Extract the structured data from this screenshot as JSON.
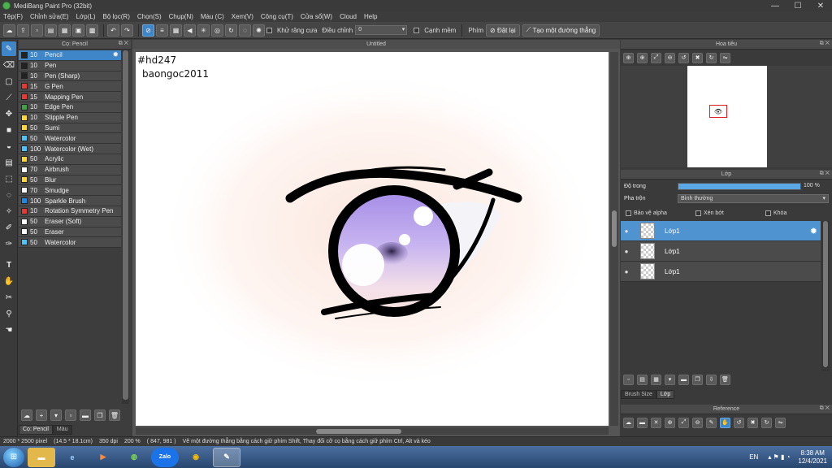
{
  "window": {
    "title": "MediBang Paint Pro (32bit)",
    "minimize": "—",
    "maximize": "☐",
    "close": "✕"
  },
  "menu": [
    "Tệp(F)",
    "Chỉnh sửa(E)",
    "Lớp(L)",
    "Bộ lọc(R)",
    "Chọn(S)",
    "Chụp(N)",
    "Màu (C)",
    "Xem(V)",
    "Công cụ(T)",
    "Cửa sổ(W)",
    "Cloud",
    "Help"
  ],
  "toolbar": {
    "antialias_label": "Khử răng cưa",
    "adjust_label": "Điều chỉnh",
    "adjust_value": "0",
    "sharp_label": "Cạnh mềm",
    "key_label": "Phím",
    "reset_label": "Đặt lại",
    "straight_label": "Tạo một đường thẳng"
  },
  "brush_panel": {
    "title": "Cọ: Pencil",
    "brushes": [
      {
        "size": "10",
        "name": "Pencil",
        "color": "#222222"
      },
      {
        "size": "10",
        "name": "Pen",
        "color": "#222222"
      },
      {
        "size": "10",
        "name": "Pen (Sharp)",
        "color": "#222222"
      },
      {
        "size": "15",
        "name": "G Pen",
        "color": "#e53935"
      },
      {
        "size": "15",
        "name": "Mapping Pen",
        "color": "#e53935"
      },
      {
        "size": "10",
        "name": "Edge Pen",
        "color": "#43a047"
      },
      {
        "size": "10",
        "name": "Stipple Pen",
        "color": "#fdd835"
      },
      {
        "size": "50",
        "name": "Sumi",
        "color": "#fdd835"
      },
      {
        "size": "50",
        "name": "Watercolor",
        "color": "#4fc3f7"
      },
      {
        "size": "100",
        "name": "Watercolor (Wet)",
        "color": "#4fc3f7"
      },
      {
        "size": "50",
        "name": "Acrylic",
        "color": "#fdd835"
      },
      {
        "size": "70",
        "name": "Airbrush",
        "color": "#ffffff"
      },
      {
        "size": "50",
        "name": "Blur",
        "color": "#fdd835"
      },
      {
        "size": "70",
        "name": "Smudge",
        "color": "#ffffff"
      },
      {
        "size": "100",
        "name": "Sparkle Brush",
        "color": "#1e88e5"
      },
      {
        "size": "10",
        "name": "Rotation Symmetry Pen",
        "color": "#e53935"
      },
      {
        "size": "50",
        "name": "Eraser (Soft)",
        "color": "#ffffff"
      },
      {
        "size": "50",
        "name": "Eraser",
        "color": "#ffffff"
      },
      {
        "size": "50",
        "name": "Watercolor",
        "color": "#4fc3f7"
      }
    ],
    "tab_brush": "Cọ: Pencil",
    "tab_color": "Màu"
  },
  "document": {
    "tab_title": "Untitled",
    "watermark_line1": "#hd247",
    "watermark_line2": "baongoc2011"
  },
  "navigator": {
    "title": "Hoa tiêu"
  },
  "layer_panel": {
    "title": "Lớp",
    "opacity_label": "Độ trong",
    "opacity_value": "100 %",
    "opacity_fraction": 1.0,
    "blend_label": "Pha trộn",
    "blend_value": "Bình thường",
    "protect_alpha": "Bảo vệ alpha",
    "clipping": "Xén bớt",
    "lock": "Khóa",
    "layers": [
      {
        "name": "Lớp1",
        "selected": true
      },
      {
        "name": "Lớp1",
        "selected": false
      },
      {
        "name": "Lớp1",
        "selected": false
      }
    ],
    "tab_brush_size": "Brush Size",
    "tab_layer": "Lớp"
  },
  "reference": {
    "title": "Reference"
  },
  "status": {
    "size": "2000 * 2500 pixel",
    "physical": "(14.5 * 18.1cm)",
    "dpi": "350 dpi",
    "zoom": "200 %",
    "coords": "( 847, 981 )",
    "hint": "Vẽ một đường thẳng bằng cách giữ phím Shift, Thay đổi cỡ cọ bằng cách giữ phím Ctrl, Alt và kéo"
  },
  "taskbar": {
    "lang": "EN",
    "time": "8:38 AM",
    "date": "12/4/2021",
    "zalo_label": "Zalo"
  }
}
